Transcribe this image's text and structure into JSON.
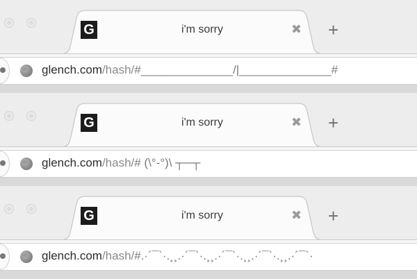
{
  "browsers": [
    {
      "tab_title": "i'm sorry",
      "favicon_letter": "G",
      "close_glyph": "✖",
      "new_tab_glyph": "+",
      "url_domain": "glench.com",
      "url_path": "/hash/",
      "url_hash": "#______________/|______________#"
    },
    {
      "tab_title": "i'm sorry",
      "favicon_letter": "G",
      "close_glyph": "✖",
      "new_tab_glyph": "+",
      "url_domain": "glench.com",
      "url_path": "/hash/",
      "url_hash": "# (\\°-°)\\ ┬─┬"
    },
    {
      "tab_title": "i'm sorry",
      "favicon_letter": "G",
      "close_glyph": "✖",
      "new_tab_glyph": "+",
      "url_domain": "glench.com",
      "url_path": "/hash/",
      "url_hash": "#.·´¯`·.¸¸.·´¯`·.¸¸.·´¯`·.¸¸.·´¯`·.¸¸.·´¯`·"
    }
  ],
  "icons": {
    "favicon": "glench-favicon-icon",
    "globe": "globe-icon",
    "close": "close-icon",
    "new_tab": "plus-icon"
  }
}
